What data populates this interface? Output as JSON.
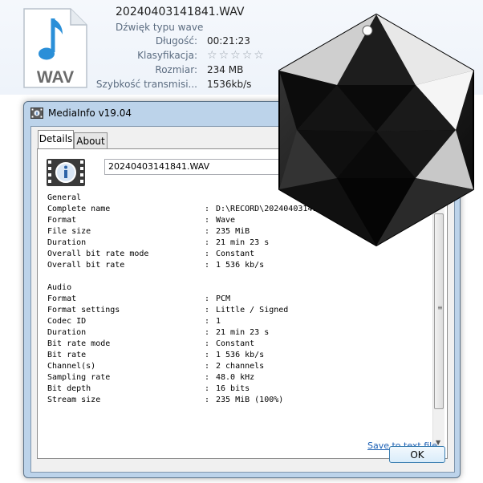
{
  "explorer": {
    "filename": "20240403141841.WAV",
    "filetype": "Dźwięk typu wave",
    "icon_label": "WAV",
    "props": [
      {
        "label": "Długość:",
        "value": "00:21:23"
      },
      {
        "label": "Klasyfikacja:",
        "value": ""
      },
      {
        "label": "Rozmiar:",
        "value": "234 MB"
      },
      {
        "label": "Szybkość transmisi...",
        "value": "1536kb/s"
      }
    ],
    "rating_stars": 0
  },
  "window": {
    "title": "MediaInfo v19.04",
    "tabs": [
      "Details",
      "About"
    ],
    "active_tab": "Details",
    "filename_field": "20240403141841.WAV",
    "report": [
      {
        "k": "General",
        "v": ""
      },
      {
        "k": "Complete name",
        "v": "D:\\RECORD\\20240403141841.WAV"
      },
      {
        "k": "Format",
        "v": "Wave"
      },
      {
        "k": "File size",
        "v": "235 MiB"
      },
      {
        "k": "Duration",
        "v": "21 min 23 s"
      },
      {
        "k": "Overall bit rate mode",
        "v": "Constant"
      },
      {
        "k": "Overall bit rate",
        "v": "1 536 kb/s"
      },
      {
        "k": "",
        "v": ""
      },
      {
        "k": "Audio",
        "v": ""
      },
      {
        "k": "Format",
        "v": "PCM"
      },
      {
        "k": "Format settings",
        "v": "Little / Signed"
      },
      {
        "k": "Codec ID",
        "v": "1"
      },
      {
        "k": "Duration",
        "v": "21 min 23 s"
      },
      {
        "k": "Bit rate mode",
        "v": "Constant"
      },
      {
        "k": "Bit rate",
        "v": "1 536 kb/s"
      },
      {
        "k": "Channel(s)",
        "v": "2 channels"
      },
      {
        "k": "Sampling rate",
        "v": "48.0 kHz"
      },
      {
        "k": "Bit depth",
        "v": "16 bits"
      },
      {
        "k": "Stream size",
        "v": "235 MiB (100%)"
      }
    ],
    "save_link": "Save to text file",
    "ok_label": "OK"
  },
  "colors": {
    "title_bar": "#bcd3ea",
    "link": "#1a5fb4",
    "gem": "#1a1a1a"
  }
}
